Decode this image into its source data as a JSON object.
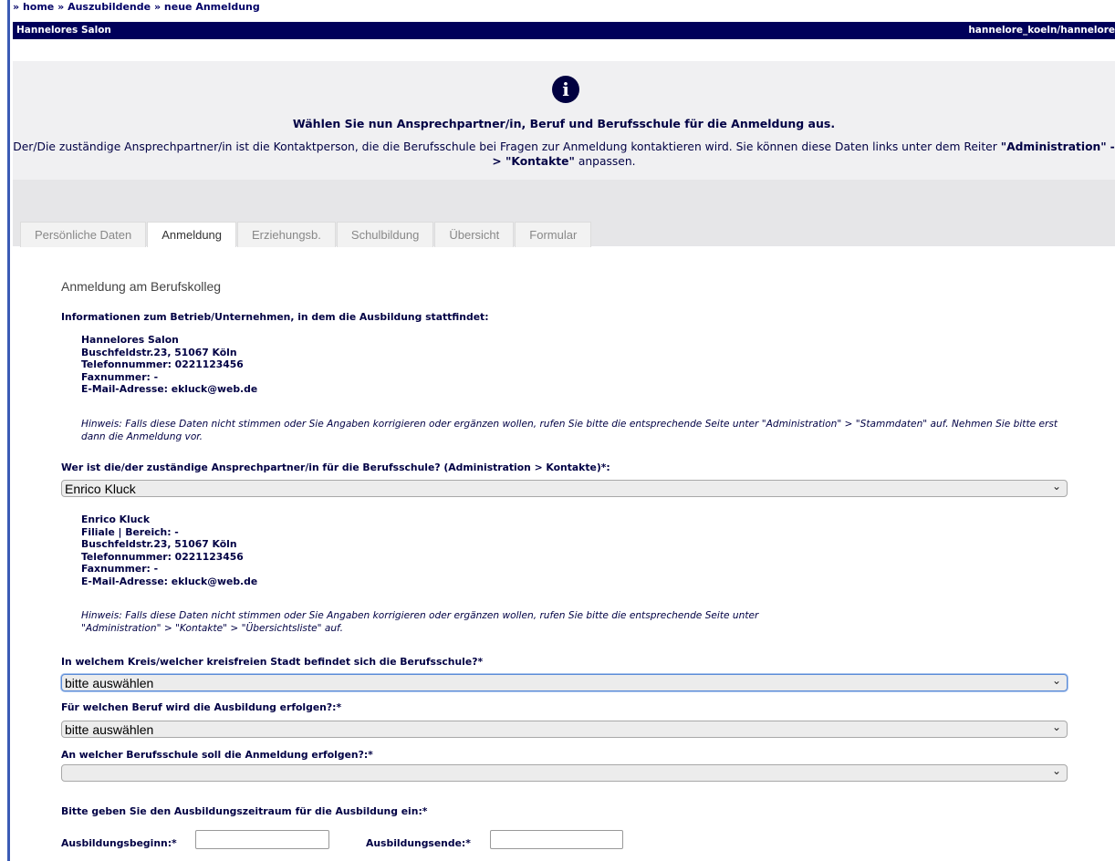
{
  "breadcrumb": {
    "prefix": "»",
    "home": "home",
    "sep1": "»",
    "trainees": "Auszubildende",
    "sep2": "»",
    "current": "neue Anmeldung"
  },
  "titlebar": {
    "company": "Hannelores Salon",
    "user": "hannelore_koeln/hannelore"
  },
  "info": {
    "icon": "info-icon",
    "title": "Wählen Sie nun Ansprechpartner/in, Beruf und Berufsschule für die Anmeldung aus.",
    "text_part1": "Der/Die zuständige Ansprechpartner/in ist die Kontaktperson, die die Berufsschule bei Fragen zur Anmeldung kontaktieren wird. Sie können diese Daten links unter dem Reiter ",
    "text_bold1": "\"Administration\"",
    "text_part2": " ",
    "text_bold2": "-> \"Kontakte\"",
    "text_part3": " anpassen."
  },
  "tabs": [
    {
      "label": "Persönliche Daten",
      "active": false
    },
    {
      "label": "Anmeldung",
      "active": true
    },
    {
      "label": "Erziehungsb.",
      "active": false
    },
    {
      "label": "Schulbildung",
      "active": false
    },
    {
      "label": "Übersicht",
      "active": false
    },
    {
      "label": "Formular",
      "active": false
    }
  ],
  "form": {
    "section_title": "Anmeldung am Berufskolleg",
    "company_info_label": "Informationen zum Betrieb/Unternehmen, in dem die Ausbildung stattfindet:",
    "company": {
      "name": "Hannelores Salon",
      "address": "Buschfeldstr.23, 51067 Köln",
      "phone": "Telefonnummer: 0221123456",
      "fax": "Faxnummer: -",
      "email": "E-Mail-Adresse: ekluck@web.de"
    },
    "company_hint": "Hinweis: Falls diese Daten nicht stimmen oder Sie Angaben korrigieren oder ergänzen wollen, rufen Sie bitte die entsprechende Seite unter \"Administration\" > \"Stammdaten\" auf. Nehmen Sie bitte erst dann die Anmeldung vor.",
    "contact_label": "Wer ist die/der zuständige Ansprechpartner/in für die Berufsschule? (Administration > Kontakte)*:",
    "contact_select": "Enrico Kluck",
    "contact": {
      "name": "Enrico Kluck",
      "branch": "Filiale | Bereich: -",
      "address": "Buschfeldstr.23, 51067 Köln",
      "phone": "Telefonnummer: 0221123456",
      "fax": "Faxnummer: -",
      "email": "E-Mail-Adresse: ekluck@web.de"
    },
    "contact_hint_line1": "Hinweis: Falls diese Daten nicht stimmen oder Sie Angaben korrigieren oder ergänzen wollen, rufen Sie bitte die entsprechende Seite unter",
    "contact_hint_line2": "\"Administration\" > \"Kontakte\" > \"Übersichtsliste\" auf.",
    "district_label": "In welchem Kreis/welcher kreisfreien Stadt befindet sich die Berufsschule?*",
    "district_select": "bitte auswählen",
    "profession_label": "Für welchen Beruf wird die Ausbildung erfolgen?:*",
    "profession_select": "bitte auswählen",
    "school_label": "An welcher Berufsschule soll die Anmeldung erfolgen?:*",
    "school_select": "",
    "period_label": "Bitte geben Sie den Ausbildungszeitraum für die Ausbildung ein:*",
    "start_label": "Ausbildungsbeginn:*",
    "start_value": "",
    "end_label": "Ausbildungsende:*",
    "end_value": ""
  },
  "icons": {
    "select_arrow": "chevron-down-icon"
  }
}
